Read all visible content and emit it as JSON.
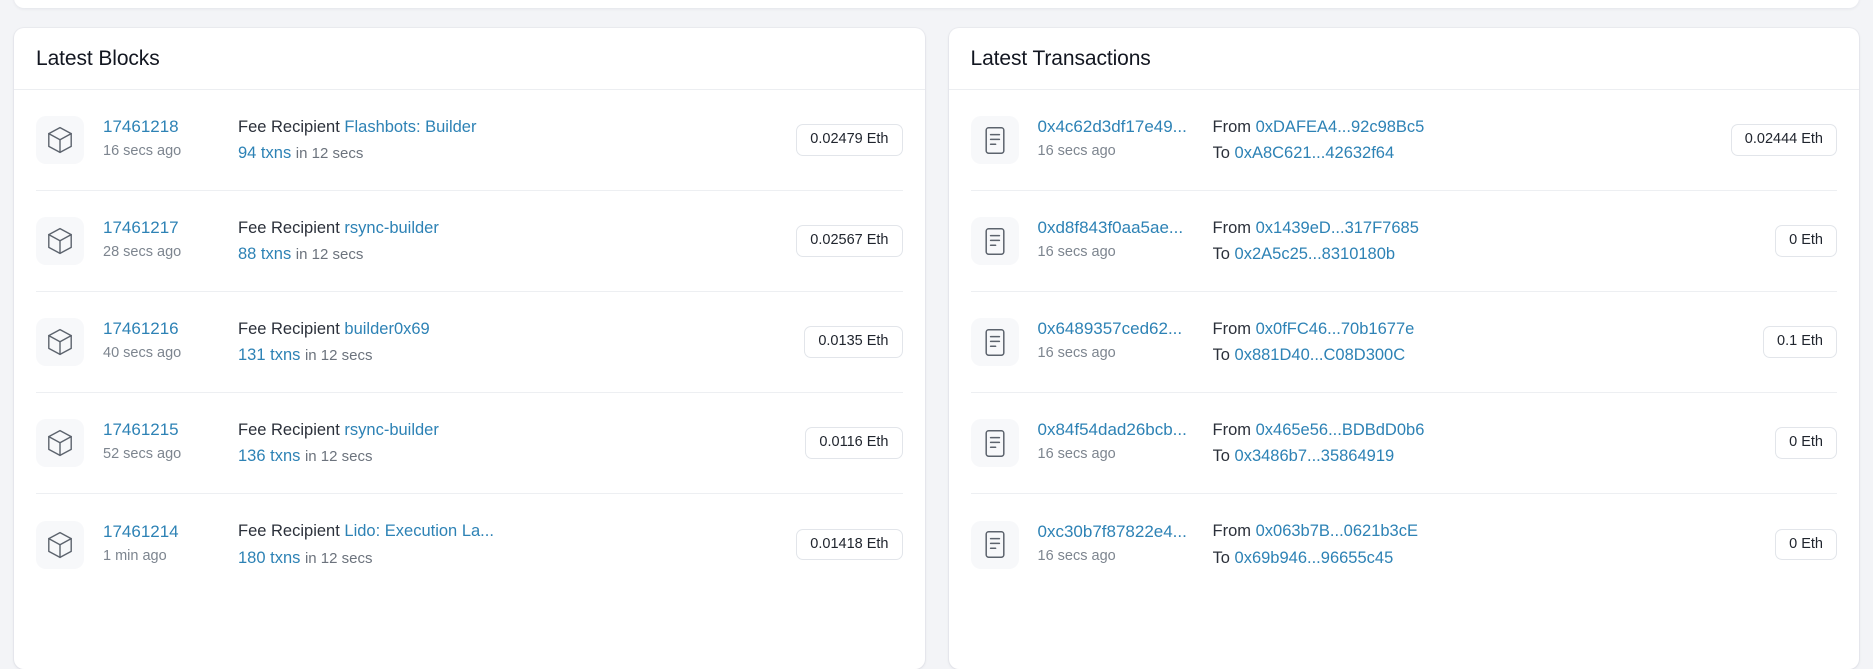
{
  "theme": {
    "page_bg": "#f3f4f7",
    "card_bg": "#ffffff",
    "link_color": "#2d82b5",
    "text_color": "#2b303a",
    "muted_color": "#7d858f",
    "divider_color": "#edeff2"
  },
  "blocks_panel": {
    "title": "Latest Blocks",
    "icon": "cube-icon",
    "fee_recipient_label": "Fee Recipient",
    "rows": [
      {
        "block": "17461218",
        "age": "16 secs ago",
        "recipient": "Flashbots: Builder",
        "txns": "94 txns",
        "duration": "in 12 secs",
        "value": "0.02479 Eth"
      },
      {
        "block": "17461217",
        "age": "28 secs ago",
        "recipient": "rsync-builder",
        "txns": "88 txns",
        "duration": "in 12 secs",
        "value": "0.02567 Eth"
      },
      {
        "block": "17461216",
        "age": "40 secs ago",
        "recipient": "builder0x69",
        "txns": "131 txns",
        "duration": "in 12 secs",
        "value": "0.0135 Eth"
      },
      {
        "block": "17461215",
        "age": "52 secs ago",
        "recipient": "rsync-builder",
        "txns": "136 txns",
        "duration": "in 12 secs",
        "value": "0.0116 Eth"
      },
      {
        "block": "17461214",
        "age": "1 min ago",
        "recipient": "Lido: Execution La...",
        "txns": "180 txns",
        "duration": "in 12 secs",
        "value": "0.01418 Eth"
      }
    ]
  },
  "transactions_panel": {
    "title": "Latest Transactions",
    "icon": "document-icon",
    "from_label": "From",
    "to_label": "To",
    "rows": [
      {
        "hash": "0x4c62d3df17e49...",
        "age": "16 secs ago",
        "from": "0xDAFEA4...92c98Bc5",
        "to": "0xA8C621...42632f64",
        "value": "0.02444 Eth"
      },
      {
        "hash": "0xd8f843f0aa5ae...",
        "age": "16 secs ago",
        "from": "0x1439eD...317F7685",
        "to": "0x2A5c25...8310180b",
        "value": "0 Eth"
      },
      {
        "hash": "0x6489357ced62...",
        "age": "16 secs ago",
        "from": "0x0fFC46...70b1677e",
        "to": "0x881D40...C08D300C",
        "value": "0.1 Eth"
      },
      {
        "hash": "0x84f54dad26bcb...",
        "age": "16 secs ago",
        "from": "0x465e56...BDBdD0b6",
        "to": "0x3486b7...35864919",
        "value": "0 Eth"
      },
      {
        "hash": "0xc30b7f87822e4...",
        "age": "16 secs ago",
        "from": "0x063b7B...0621b3cE",
        "to": "0x69b946...96655c45",
        "value": "0 Eth"
      }
    ]
  }
}
